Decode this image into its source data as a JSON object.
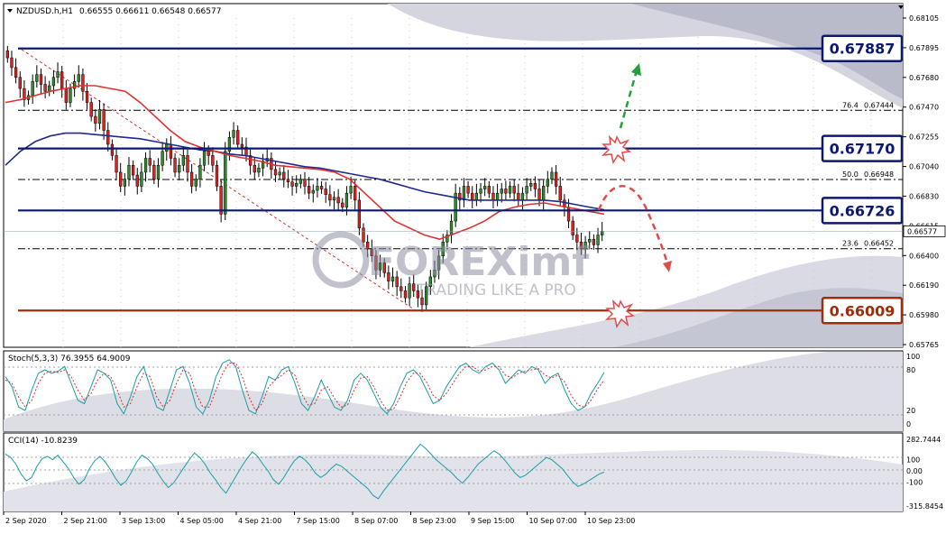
{
  "header": {
    "symbol_timeframe": "NZDUSD.h,H1",
    "ohlc": "0.66555 0.66611 0.66548 0.66577"
  },
  "watermark": {
    "brand": "FOREXimf",
    "tagline": "TRADING LIKE A PRO"
  },
  "colors": {
    "bull": "#2e8b2e",
    "bear": "#e02020",
    "ma_fast": "#e03030",
    "ma_slow": "#1f2a8c",
    "level": "#0d1870",
    "support": "#9c2e0e",
    "stoch_main": "#1a9da8",
    "stoch_signal": "#d03030",
    "cci": "#1a9da8",
    "arrow_up": "#22a03c",
    "arrow_down": "#e34a4a"
  },
  "chart_data": [
    {
      "type": "candlestick",
      "panel": "price",
      "ylim": [
        0.65765,
        0.68105
      ],
      "price_ticks": [
        "0.68105",
        "0.67895",
        "0.67680",
        "0.67470",
        "0.67255",
        "0.67040",
        "0.66830",
        "0.66615",
        "0.66400",
        "0.66190",
        "0.65980",
        "0.65765"
      ],
      "current_price": "0.66577",
      "x_labels": [
        "2 Sep 2020",
        "2 Sep 21:00",
        "3 Sep 13:00",
        "4 Sep 05:00",
        "4 Sep 21:00",
        "7 Sep 15:00",
        "8 Sep 07:00",
        "8 Sep 23:00",
        "9 Sep 15:00",
        "10 Sep 07:00",
        "10 Sep 23:00"
      ],
      "closes": [
        0.6782,
        0.6775,
        0.6768,
        0.676,
        0.6752,
        0.6755,
        0.6765,
        0.677,
        0.6763,
        0.6758,
        0.6762,
        0.6768,
        0.6772,
        0.676,
        0.675,
        0.676,
        0.6765,
        0.677,
        0.6758,
        0.675,
        0.674,
        0.6735,
        0.6745,
        0.673,
        0.672,
        0.6712,
        0.67,
        0.669,
        0.6695,
        0.6705,
        0.6698,
        0.669,
        0.67,
        0.671,
        0.6705,
        0.6695,
        0.6705,
        0.6715,
        0.672,
        0.671,
        0.67,
        0.6705,
        0.6712,
        0.67,
        0.669,
        0.6695,
        0.6705,
        0.6715,
        0.6712,
        0.6705,
        0.669,
        0.667,
        0.6715,
        0.6725,
        0.673,
        0.672,
        0.6718,
        0.6712,
        0.6705,
        0.67,
        0.6703,
        0.6708,
        0.671,
        0.6702,
        0.6698,
        0.67,
        0.6695,
        0.6693,
        0.669,
        0.6692,
        0.6695,
        0.669,
        0.6685,
        0.6687,
        0.669,
        0.6688,
        0.6684,
        0.668,
        0.6682,
        0.6678,
        0.6675,
        0.6685,
        0.669,
        0.668,
        0.666,
        0.665,
        0.6645,
        0.664,
        0.663,
        0.6635,
        0.6628,
        0.6622,
        0.6625,
        0.6618,
        0.6615,
        0.661,
        0.662,
        0.6615,
        0.661,
        0.6605,
        0.6618,
        0.6625,
        0.663,
        0.664,
        0.665,
        0.6655,
        0.6665,
        0.6685,
        0.668,
        0.669,
        0.6685,
        0.668,
        0.6685,
        0.6688,
        0.669,
        0.6685,
        0.668,
        0.6685,
        0.6688,
        0.6685,
        0.669,
        0.6685,
        0.668,
        0.6685,
        0.669,
        0.6692,
        0.6688,
        0.668,
        0.669,
        0.6695,
        0.67,
        0.669,
        0.668,
        0.6675,
        0.6665,
        0.6655,
        0.665,
        0.6645,
        0.665,
        0.6652,
        0.6648,
        0.6655,
        0.66577
      ],
      "ma_fast": [
        0.675,
        0.6752,
        0.6755,
        0.6758,
        0.676,
        0.6762,
        0.6762,
        0.676,
        0.6758,
        0.675,
        0.674,
        0.673,
        0.6722,
        0.6718,
        0.6715,
        0.6712,
        0.671,
        0.6708,
        0.6705,
        0.6704,
        0.6703,
        0.6702,
        0.67,
        0.6695,
        0.6685,
        0.6675,
        0.6665,
        0.666,
        0.6655,
        0.6652,
        0.6656,
        0.666,
        0.6665,
        0.6672,
        0.6675,
        0.6677,
        0.6678,
        0.6676,
        0.6674,
        0.6672,
        0.667
      ],
      "ma_slow": [
        0.6705,
        0.6715,
        0.6722,
        0.6726,
        0.6728,
        0.6728,
        0.6727,
        0.6726,
        0.6725,
        0.6724,
        0.6722,
        0.672,
        0.6718,
        0.6716,
        0.6715,
        0.6713,
        0.6712,
        0.671,
        0.6708,
        0.6706,
        0.6704,
        0.6703,
        0.6701,
        0.6699,
        0.6697,
        0.6695,
        0.6692,
        0.6689,
        0.6686,
        0.6684,
        0.6682,
        0.668,
        0.668,
        0.668,
        0.668,
        0.668,
        0.668,
        0.6679,
        0.6677,
        0.6675,
        0.6673
      ],
      "levels": [
        {
          "label": "0.67887",
          "value": 0.67887,
          "role": "resistance"
        },
        {
          "label": "0.67170",
          "value": 0.6717,
          "role": "resistance"
        },
        {
          "label": "0.66726",
          "value": 0.66726,
          "role": "pivot"
        },
        {
          "label": "0.66009",
          "value": 0.66009,
          "role": "support"
        }
      ],
      "fibonacci": [
        {
          "level": "76.4",
          "price": "0.67444",
          "value": 0.67444
        },
        {
          "level": "50.0",
          "price": "0.66948",
          "value": 0.66948
        },
        {
          "level": "23.6",
          "price": "0.66452",
          "value": 0.66452
        }
      ],
      "scenarios": [
        "bullish-breakout-above-0.67170",
        "bearish-rejection-from-0.66726"
      ]
    },
    {
      "type": "line",
      "panel": "stochastic",
      "label": "Stoch(5,3,3) 76.3955 64.9009",
      "ylim": [
        0,
        100
      ],
      "ticks": [
        "100",
        "80",
        "20",
        "0"
      ],
      "series": [
        {
          "name": "main",
          "values": [
            70,
            55,
            25,
            20,
            50,
            75,
            80,
            75,
            78,
            85,
            60,
            35,
            30,
            55,
            80,
            75,
            65,
            30,
            15,
            40,
            70,
            85,
            55,
            25,
            20,
            50,
            80,
            85,
            60,
            25,
            15,
            35,
            70,
            90,
            95,
            85,
            50,
            20,
            15,
            40,
            70,
            65,
            80,
            85,
            60,
            30,
            20,
            40,
            65,
            45,
            25,
            20,
            35,
            65,
            75,
            65,
            45,
            25,
            15,
            30,
            55,
            75,
            80,
            70,
            50,
            30,
            35,
            55,
            70,
            85,
            90,
            80,
            75,
            85,
            90,
            80,
            60,
            70,
            80,
            75,
            85,
            80,
            60,
            70,
            75,
            50,
            30,
            20,
            25,
            45,
            60,
            76.4
          ]
        },
        {
          "name": "signal",
          "values": [
            65,
            60,
            40,
            25,
            35,
            60,
            75,
            78,
            76,
            80,
            70,
            50,
            35,
            45,
            65,
            75,
            70,
            50,
            25,
            30,
            55,
            75,
            70,
            40,
            25,
            35,
            60,
            80,
            75,
            45,
            25,
            25,
            50,
            75,
            90,
            90,
            70,
            40,
            20,
            30,
            55,
            65,
            72,
            80,
            72,
            45,
            28,
            30,
            50,
            55,
            38,
            25,
            28,
            50,
            68,
            70,
            55,
            35,
            20,
            22,
            40,
            62,
            75,
            75,
            62,
            42,
            35,
            45,
            60,
            75,
            85,
            85,
            78,
            80,
            85,
            85,
            72,
            68,
            75,
            78,
            80,
            82,
            72,
            68,
            72,
            62,
            42,
            28,
            25,
            35,
            52,
            64.9
          ]
        }
      ]
    },
    {
      "type": "line",
      "panel": "cci",
      "label": "CCI(14) -10.8239",
      "ylim": [
        -315.8454,
        282.7444
      ],
      "ticks": [
        "282.7444",
        "100",
        "0.00",
        "-100",
        "-315.8454"
      ],
      "series": [
        {
          "name": "CCI(14)",
          "values": [
            150,
            120,
            60,
            -30,
            -90,
            -60,
            40,
            110,
            130,
            100,
            140,
            80,
            20,
            -60,
            -120,
            -80,
            20,
            90,
            130,
            80,
            10,
            -70,
            -130,
            -90,
            -10,
            80,
            140,
            110,
            60,
            -20,
            -90,
            -150,
            -110,
            -40,
            30,
            100,
            160,
            120,
            60,
            -20,
            -80,
            -150,
            -200,
            -120,
            -40,
            40,
            110,
            170,
            130,
            60,
            0,
            -80,
            -120,
            -60,
            20,
            90,
            130,
            100,
            50,
            -20,
            -60,
            -30,
            20,
            60,
            40,
            0,
            -40,
            -80,
            -120,
            -160,
            -220,
            -250,
            -180,
            -120,
            -60,
            0,
            60,
            120,
            180,
            240,
            200,
            150,
            100,
            60,
            20,
            -20,
            -70,
            -110,
            -60,
            0,
            60,
            100,
            140,
            180,
            150,
            100,
            40,
            -20,
            -60,
            -40,
            0,
            40,
            80,
            120,
            100,
            60,
            20,
            -40,
            -100,
            -140,
            -120,
            -90,
            -60,
            -30,
            -10.8
          ]
        }
      ]
    }
  ]
}
